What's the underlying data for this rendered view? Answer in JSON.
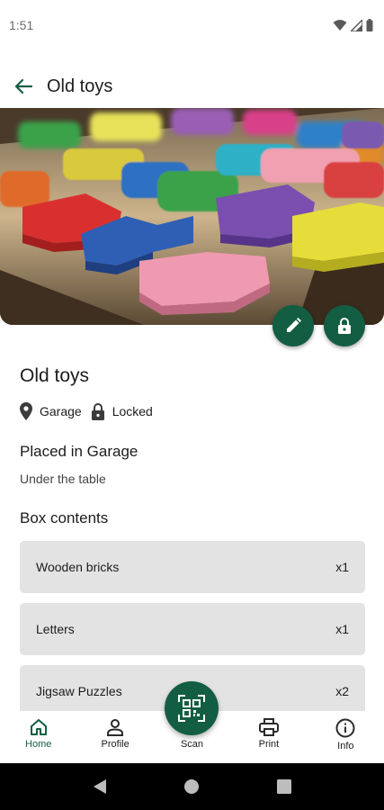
{
  "status": {
    "time": "1:51"
  },
  "app_bar": {
    "title": "Old toys"
  },
  "hero": {
    "subject": "wooden alphabet puzzle photo"
  },
  "box": {
    "name": "Old toys",
    "location": "Garage",
    "lock_status": "Locked",
    "placed_in": "Placed in Garage",
    "description": "Under the table"
  },
  "contents": {
    "heading": "Box contents",
    "items": [
      {
        "name": "Wooden bricks",
        "qty": "x1"
      },
      {
        "name": "Letters",
        "qty": "x1"
      },
      {
        "name": "Jigsaw Puzzles",
        "qty": "x2"
      }
    ]
  },
  "nav": {
    "items": [
      {
        "label": "Home",
        "icon": "home-icon"
      },
      {
        "label": "Profile",
        "icon": "person-icon"
      },
      {
        "label": "Scan",
        "icon": "qr-code-icon"
      },
      {
        "label": "Print",
        "icon": "printer-icon"
      },
      {
        "label": "Info",
        "icon": "info-icon"
      }
    ]
  },
  "colors": {
    "primary": "#135e43",
    "card": "#e3e3e3",
    "text": "#1c1c1c"
  }
}
